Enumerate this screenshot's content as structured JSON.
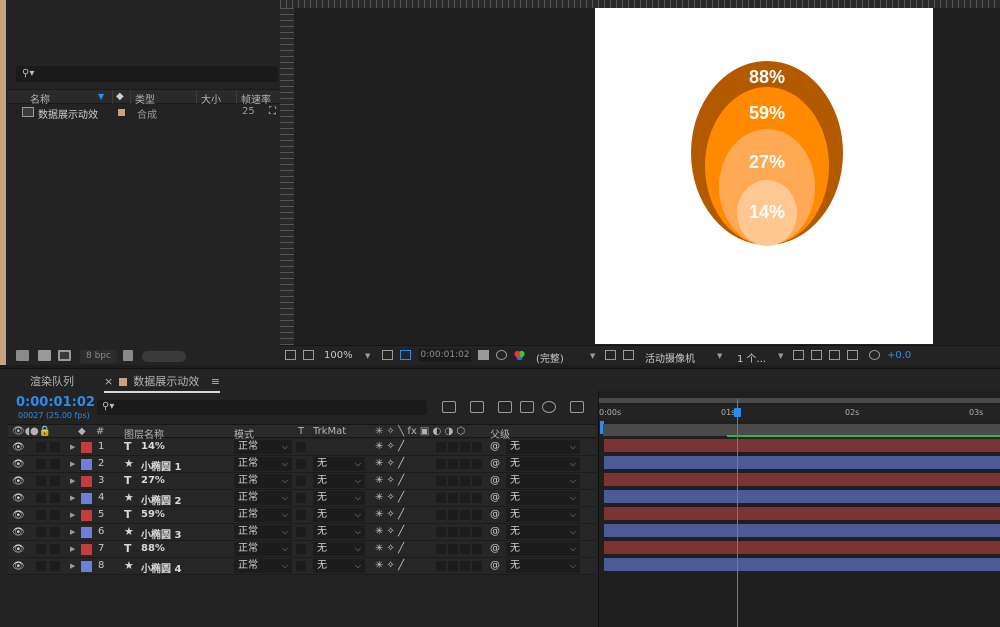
{
  "colors": {
    "accent_blue": "#2d8ceb",
    "label_red": "#c43c3c",
    "label_blue": "#6d7fd9",
    "bar_red": "#7a3434",
    "bar_blue": "#4c5a95",
    "comp_swatch": "#c8a27a",
    "circle_1": "#b35a00",
    "circle_2": "#ff8a00",
    "circle_3": "#ffa955",
    "circle_4": "#ffc792"
  },
  "project": {
    "search_placeholder": "",
    "columns": {
      "name": "名称",
      "type": "类型",
      "size": "大小",
      "fps": "帧速率"
    },
    "items": [
      {
        "name": "数据展示动效",
        "type": "合成",
        "fps": "25",
        "icon": "composition-icon"
      }
    ],
    "footer": {
      "bpc": "8 bpc"
    }
  },
  "viewer": {
    "canvas_labels": [
      "88%",
      "59%",
      "27%",
      "14%"
    ],
    "toolbar": {
      "zoom": "100%",
      "timecode": "0:00:01:02",
      "resolution": "(完整)",
      "camera": "活动摄像机",
      "views": "1 个...",
      "exposure": "+0.0"
    }
  },
  "timeline": {
    "tabs": {
      "render_queue": "渲染队列",
      "comp": "数据展示动效"
    },
    "timecode": "0:00:01:02",
    "fps_note": "00027 (25.00 fps)",
    "columns": {
      "num": "#",
      "layer_name": "图层名称",
      "mode": "模式",
      "t": "T",
      "trkmat": "TrkMat",
      "parent": "父级"
    },
    "ruler": [
      "0:00s",
      "01s",
      "02s",
      "03s"
    ],
    "layers": [
      {
        "num": "1",
        "type": "T",
        "name": "14%",
        "mode": "正常",
        "trkmat": "",
        "parent": "无",
        "label": "red"
      },
      {
        "num": "2",
        "type": "★",
        "name": "小椭圆 1",
        "mode": "正常",
        "trkmat": "无",
        "parent": "无",
        "label": "blue"
      },
      {
        "num": "3",
        "type": "T",
        "name": "27%",
        "mode": "正常",
        "trkmat": "无",
        "parent": "无",
        "label": "red"
      },
      {
        "num": "4",
        "type": "★",
        "name": "小椭圆 2",
        "mode": "正常",
        "trkmat": "无",
        "parent": "无",
        "label": "blue"
      },
      {
        "num": "5",
        "type": "T",
        "name": "59%",
        "mode": "正常",
        "trkmat": "无",
        "parent": "无",
        "label": "red"
      },
      {
        "num": "6",
        "type": "★",
        "name": "小椭圆 3",
        "mode": "正常",
        "trkmat": "无",
        "parent": "无",
        "label": "blue"
      },
      {
        "num": "7",
        "type": "T",
        "name": "88%",
        "mode": "正常",
        "trkmat": "无",
        "parent": "无",
        "label": "red"
      },
      {
        "num": "8",
        "type": "★",
        "name": "小椭圆 4",
        "mode": "正常",
        "trkmat": "无",
        "parent": "无",
        "label": "blue"
      }
    ]
  }
}
